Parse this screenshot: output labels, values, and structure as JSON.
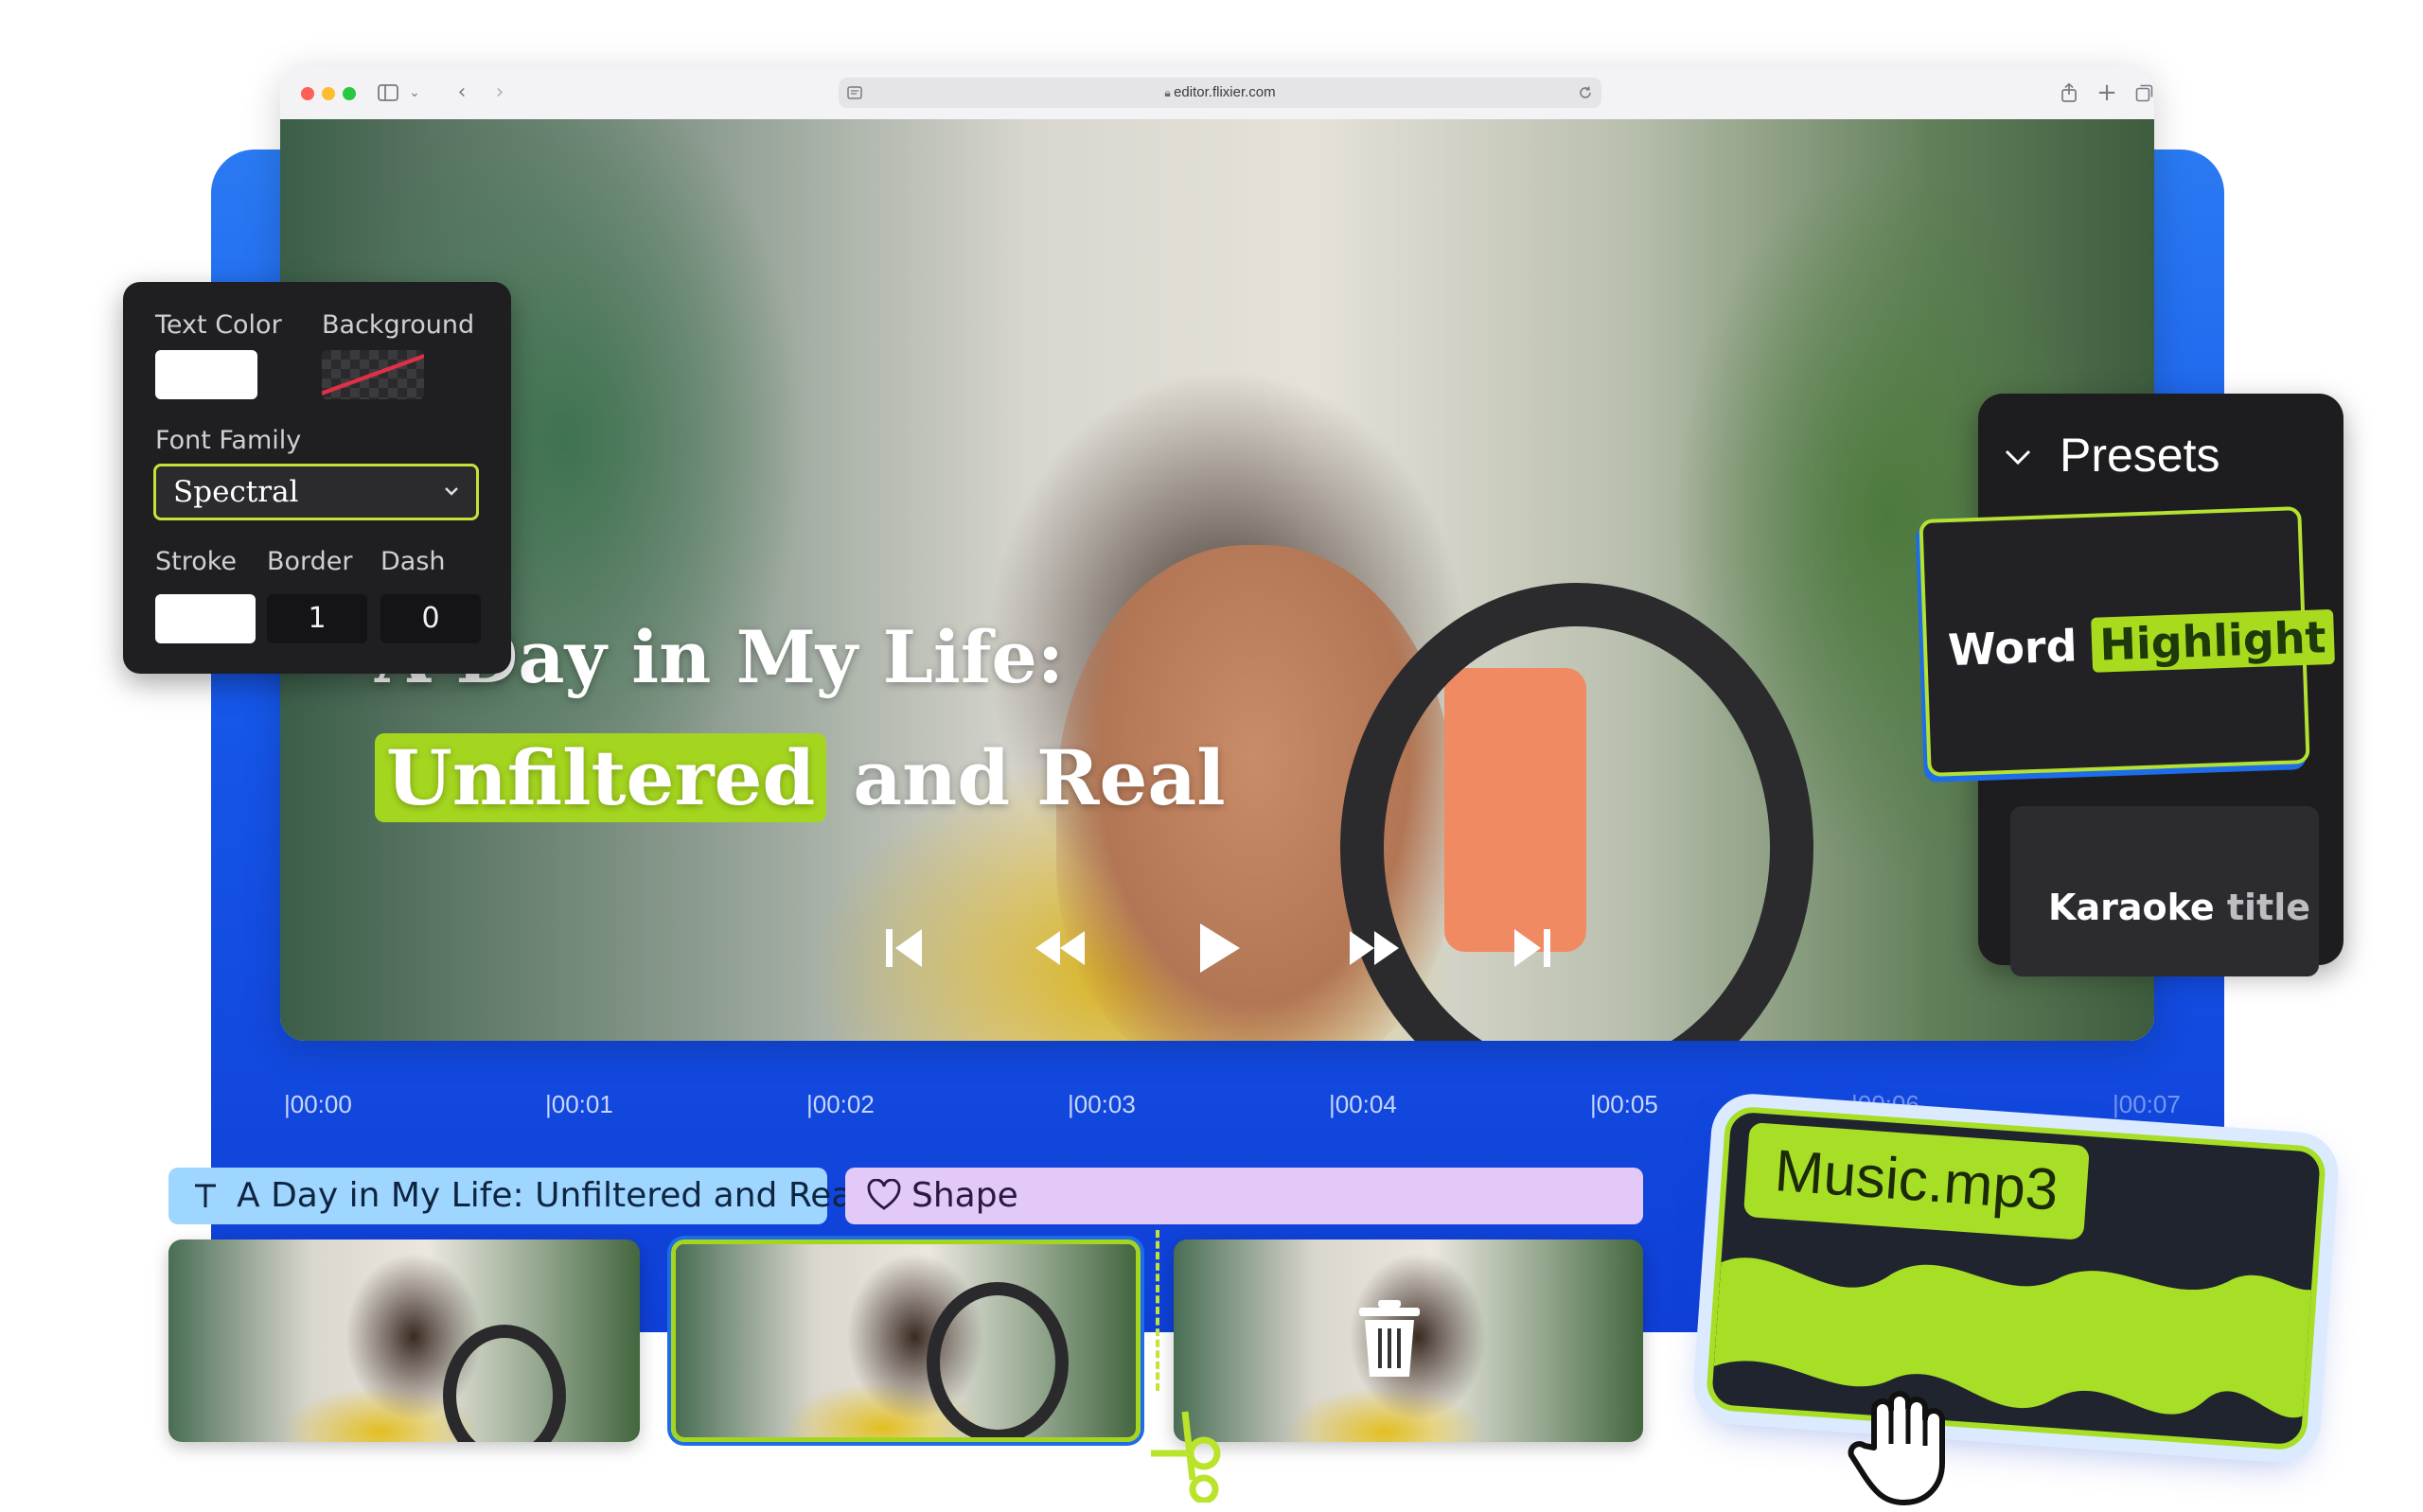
{
  "browser": {
    "url": "editor.flixier.com",
    "traffic_lights": {
      "close": "#ff5f57",
      "minimize": "#febc2e",
      "zoom": "#28c840"
    },
    "icons": [
      "sidebar-icon",
      "chevron-down-icon",
      "back-icon",
      "forward-icon",
      "reader-icon",
      "lock-icon",
      "reload-icon",
      "share-icon",
      "new-tab-icon",
      "tabs-icon"
    ]
  },
  "video": {
    "title_line1": "A Day in My Life:",
    "title_highlight": "Unfiltered",
    "title_rest": "and Real",
    "controls": [
      "skip-back-icon",
      "rewind-icon",
      "play-icon",
      "fast-forward-icon",
      "skip-forward-icon"
    ]
  },
  "style_panel": {
    "text_color_label": "Text Color",
    "background_label": "Background",
    "font_family_label": "Font Family",
    "font_family_value": "Spectral",
    "stroke_label": "Stroke",
    "border_label": "Border",
    "border_value": "1",
    "dash_label": "Dash",
    "dash_value": "0",
    "accent": "#c4e338"
  },
  "presets": {
    "title": "Presets",
    "card1_word": "Word",
    "card1_highlight": "Highlight",
    "card2_word": "Karaoke",
    "card2_rest": "title"
  },
  "timeline": {
    "ticks": [
      "00:00",
      "00:01",
      "00:02",
      "00:03",
      "00:04",
      "00:05",
      "00:06",
      "00:07"
    ],
    "text_track": "A Day in My Life: Unfiltered and Real",
    "shape_track": "Shape",
    "music_track": "Music.mp3",
    "colors": {
      "text_track": "#9ed6ff",
      "shape_track": "#e3c9f8",
      "music_accent": "#a7de26"
    }
  }
}
